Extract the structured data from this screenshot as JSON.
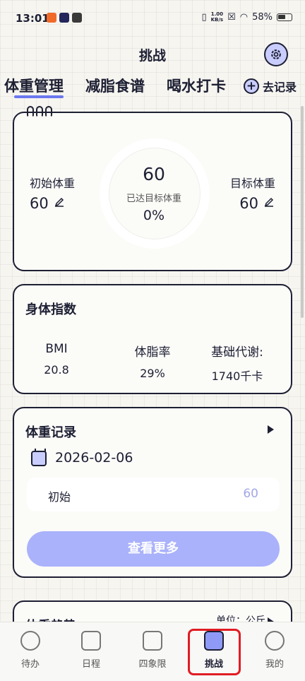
{
  "status": {
    "time": "13:01",
    "net_speed_value": "1.00",
    "net_speed_unit": "KB/s",
    "battery": "58%"
  },
  "header": {
    "title": "挑战"
  },
  "tabs": [
    {
      "label": "体重管理",
      "active": true
    },
    {
      "label": "减脂食谱",
      "active": false
    },
    {
      "label": "喝水打卡",
      "active": false
    }
  ],
  "add_record_label": "去记录",
  "weight": {
    "current": "60",
    "caption": "已达目标体重",
    "progress": "0%",
    "initial_label": "初始体重",
    "initial_value": "60",
    "target_label": "目标体重",
    "target_value": "60"
  },
  "body_index": {
    "title": "身体指数",
    "metrics": [
      {
        "label": "BMI",
        "value": "20.8"
      },
      {
        "label": "体脂率",
        "value": "29%"
      },
      {
        "label": "基础代谢:",
        "value": "1740千卡"
      }
    ]
  },
  "weight_record": {
    "title": "体重记录",
    "date": "2026-02-06",
    "row_label": "初始",
    "row_value": "60",
    "more_label": "查看更多"
  },
  "trend": {
    "title": "体重趋势",
    "unit": "单位：公斤"
  },
  "nav": [
    {
      "label": "待办",
      "icon": "gear-icon"
    },
    {
      "label": "日程",
      "icon": "calendar-check-icon"
    },
    {
      "label": "四象限",
      "icon": "book-icon"
    },
    {
      "label": "挑战",
      "icon": "phone-icon",
      "active": true
    },
    {
      "label": "我的",
      "icon": "person-icon"
    }
  ],
  "colors": {
    "accent": "#6b78f0",
    "accent_light": "#aab2fb",
    "highlight": "#e11c23"
  }
}
